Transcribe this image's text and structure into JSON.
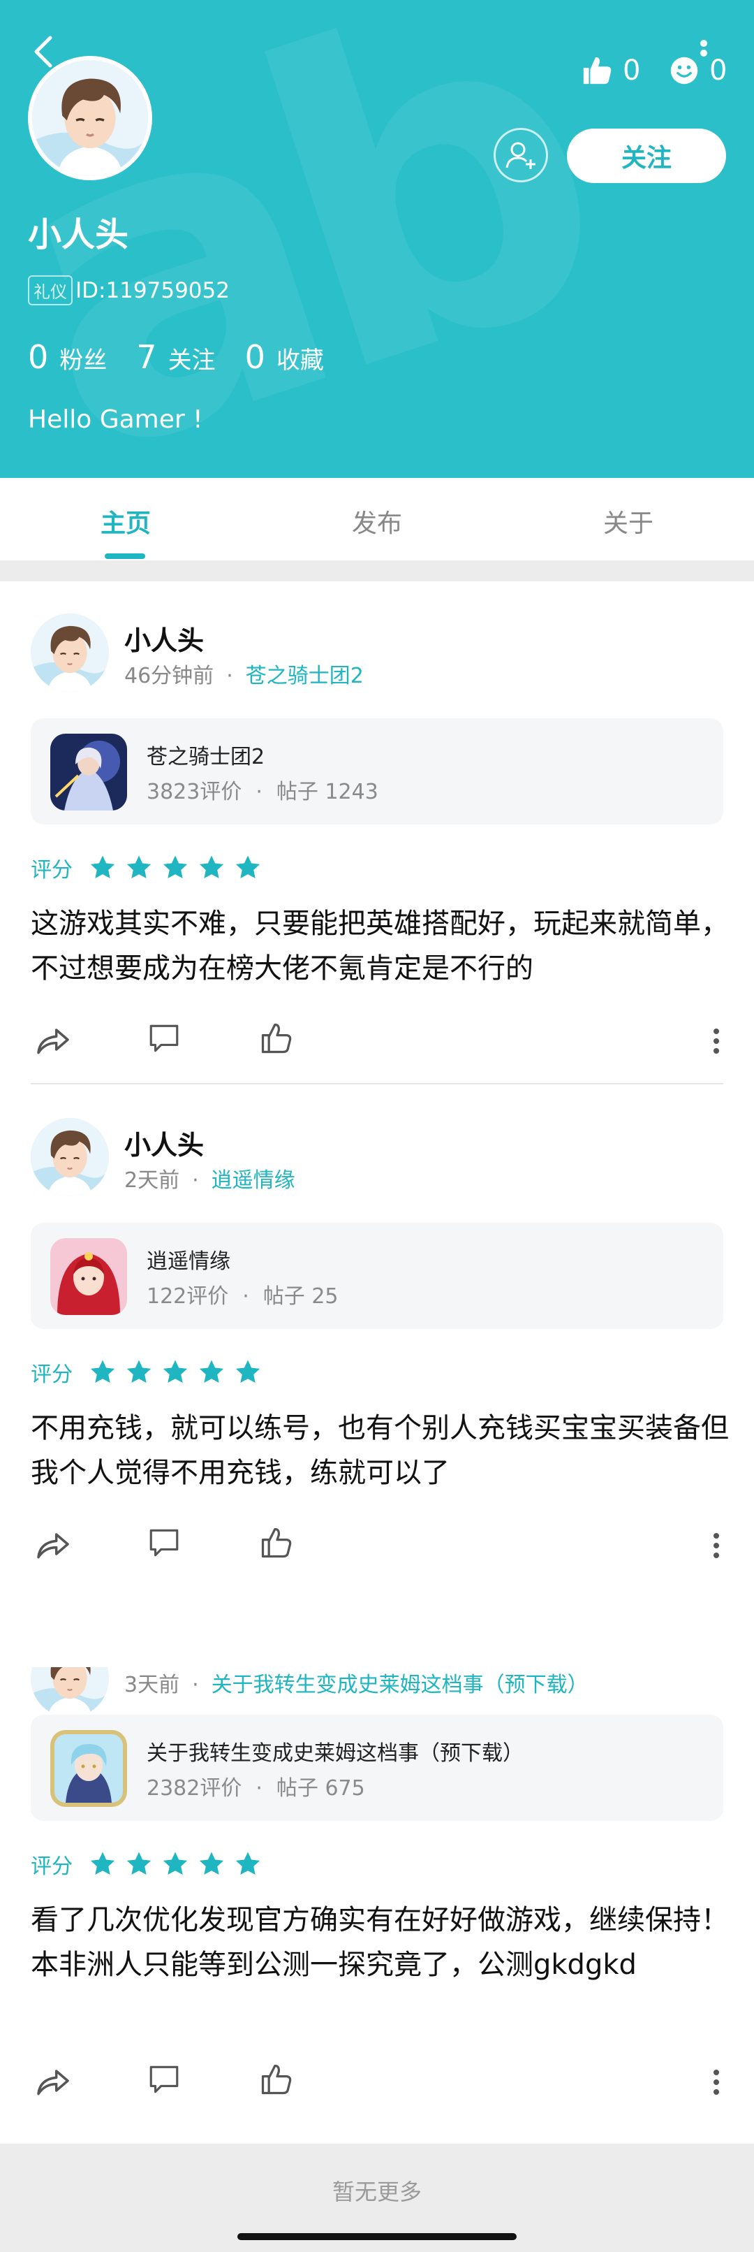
{
  "header": {
    "username": "小人头",
    "id_badge": "礼仪",
    "id_text": "ID:119759052",
    "likes_count": "0",
    "smiles_count": "0",
    "follow_label": "关注",
    "bio": "Hello Gamer !",
    "stats": [
      {
        "num": "0",
        "label": "粉丝"
      },
      {
        "num": "7",
        "label": "关注"
      },
      {
        "num": "0",
        "label": "收藏"
      }
    ],
    "bg_color": "#2bbfc9"
  },
  "tabs": [
    {
      "label": "主页",
      "active": true
    },
    {
      "label": "发布",
      "active": false
    },
    {
      "label": "关于",
      "active": false
    }
  ],
  "posts": [
    {
      "name": "小人头",
      "time": "46分钟前",
      "dot": "·",
      "game_link": "苍之骑士团2",
      "game": {
        "title": "苍之骑士团2",
        "reviews": "3823评价",
        "dot": "·",
        "posts": "帖子 1243",
        "icon": "knight-game-icon"
      },
      "rating_label": "评分",
      "rating": 5,
      "body": "这游戏其实不难，只要能把英雄搭配好，玩起来就简单，不过想要成为在榜大佬不氪肯定是不行的"
    },
    {
      "name": "小人头",
      "time": "2天前",
      "dot": "·",
      "game_link": "逍遥情缘",
      "game": {
        "title": "逍遥情缘",
        "reviews": "122评价",
        "dot": "·",
        "posts": "帖子 25",
        "icon": "fairy-game-icon"
      },
      "rating_label": "评分",
      "rating": 5,
      "body": "不用充钱，就可以练号，也有个别人充钱买宝宝买装备但我个人觉得不用充钱，练就可以了"
    },
    {
      "name": "",
      "time": "3天前",
      "dot": "·",
      "game_link": "关于我转生变成史莱姆这档事（预下载）",
      "game": {
        "title": "关于我转生变成史莱姆这档事（预下载）",
        "reviews": "2382评价",
        "dot": "·",
        "posts": "帖子 675",
        "icon": "slime-game-icon"
      },
      "rating_label": "评分",
      "rating": 5,
      "body": "看了几次优化发现官方确实有在好好做游戏，继续保持！本非洲人只能等到公测一探究竟了，公测gkdgkd"
    }
  ],
  "footer": {
    "text": "暂无更多"
  },
  "colors": {
    "accent": "#1fb5c1",
    "star": "#1fb5c1"
  }
}
